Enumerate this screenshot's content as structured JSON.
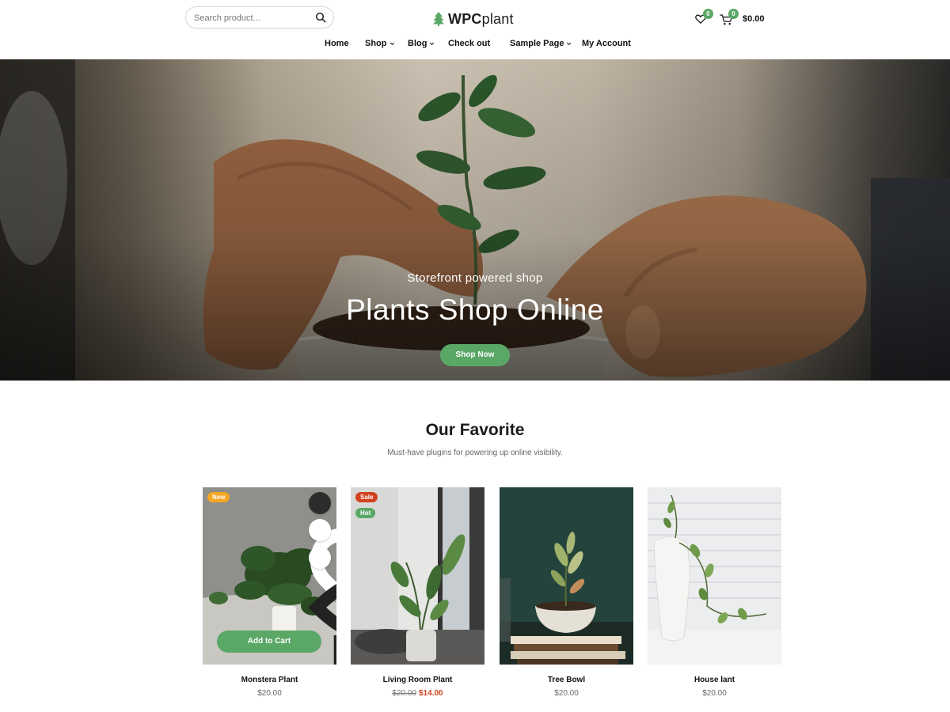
{
  "header": {
    "search": {
      "placeholder": "Search product..."
    },
    "logo": {
      "bold": "WPC",
      "light": "plant"
    },
    "wishlist_count": "0",
    "cart_count": "0",
    "cart_total": "$0.00"
  },
  "nav": {
    "items": [
      {
        "label": "Home",
        "dropdown": false
      },
      {
        "label": "Shop",
        "dropdown": true
      },
      {
        "label": "Blog",
        "dropdown": true
      },
      {
        "label": "Check out",
        "dropdown": false
      },
      {
        "label": "Sample Page",
        "dropdown": true
      },
      {
        "label": "My Account",
        "dropdown": false
      }
    ]
  },
  "hero": {
    "subtitle": "Storefront powered shop",
    "title": "Plants Shop Online",
    "button_label": "Shop Now"
  },
  "section": {
    "title": "Our Favorite",
    "subtitle": "Must-have plugins for powering up online visibility."
  },
  "products": [
    {
      "name": "Monstera Plant",
      "price": "$20.00",
      "badges": [
        "New"
      ],
      "add_to_cart_label": "Add to Cart"
    },
    {
      "name": "Living Room Plant",
      "old_price": "$20.00",
      "price": "$14.00",
      "badges": [
        "Sale",
        "Hot"
      ]
    },
    {
      "name": "Tree Bowl",
      "price": "$20.00",
      "badges": []
    },
    {
      "name": "House lant",
      "price": "$20.00",
      "badges": []
    }
  ],
  "colors": {
    "accent": "#5aa766",
    "sale": "#d0421e",
    "new": "#f5a623"
  }
}
